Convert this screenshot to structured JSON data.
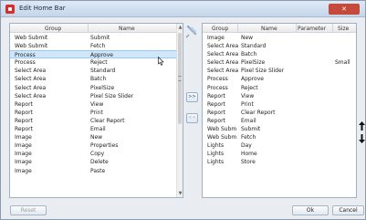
{
  "window": {
    "title": "Edit Home Bar"
  },
  "left_list": {
    "columns": [
      "Group",
      "Name"
    ],
    "rows": [
      [
        "Web Submit",
        "Submit"
      ],
      [
        "Web Submit",
        "Fetch"
      ],
      [
        "Process",
        "Approve"
      ],
      [
        "Process",
        "Reject"
      ],
      [
        "Select Area",
        "Standard"
      ],
      [
        "Select Area",
        "Batch"
      ],
      [
        "Select Area",
        "PixelSize"
      ],
      [
        "Select Area",
        "Pixel Size Slider"
      ],
      [
        "Report",
        "View"
      ],
      [
        "Report",
        "Print"
      ],
      [
        "Report",
        "Clear Report"
      ],
      [
        "Report",
        "Email"
      ],
      [
        "Image",
        "New"
      ],
      [
        "Image",
        "Properties"
      ],
      [
        "Image",
        "Copy"
      ],
      [
        "Image",
        "Delete"
      ],
      [
        "Image",
        "Paste"
      ]
    ],
    "selected_index": 2
  },
  "right_list": {
    "columns": [
      "Group",
      "Name",
      "Parameter",
      "Size"
    ],
    "rows": [
      [
        "Image",
        "New",
        "",
        ""
      ],
      [
        "Select Area",
        "Standard",
        "",
        ""
      ],
      [
        "Select Area",
        "Batch",
        "",
        ""
      ],
      [
        "Select Area",
        "PixelSize",
        "",
        "Small"
      ],
      [
        "Select Area",
        "Pixel Size Slider",
        "",
        ""
      ],
      [
        "Process",
        "Approve",
        "",
        ""
      ],
      [
        "Process",
        "Reject",
        "",
        ""
      ],
      [
        "Report",
        "View",
        "",
        ""
      ],
      [
        "Report",
        "Print",
        "",
        ""
      ],
      [
        "Report",
        "Clear Report",
        "",
        ""
      ],
      [
        "Report",
        "Email",
        "",
        ""
      ],
      [
        "Web Subm",
        "Submit",
        "",
        ""
      ],
      [
        "Web Subm",
        "Fetch",
        "",
        ""
      ],
      [
        "Lights",
        "Day",
        "",
        ""
      ],
      [
        "Lights",
        "Home",
        "",
        ""
      ],
      [
        "Lights",
        "Store",
        "",
        ""
      ]
    ]
  },
  "buttons": {
    "add": ">>",
    "remove": "<<",
    "reset": "Reset",
    "ok": "Ok",
    "cancel": "Cancel"
  },
  "icons": {
    "app": "app-icon",
    "close": "close-icon",
    "pin": "pin-icon",
    "updown": "up-down-arrows-icon"
  },
  "colors": {
    "selection": "#cfe6fb",
    "close_button": "#c64a3c"
  }
}
